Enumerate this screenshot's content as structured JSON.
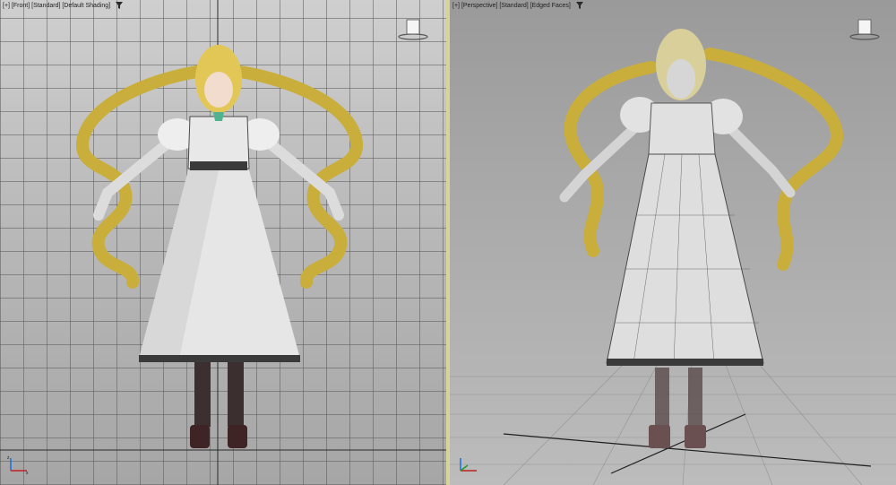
{
  "viewports": {
    "front": {
      "label_plus": "[+]",
      "label_view": "[Front]",
      "label_style": "[Standard]",
      "label_shading": "[Default Shading]"
    },
    "perspective": {
      "label_plus": "[+]",
      "label_view": "[Perspective]",
      "label_style": "[Standard]",
      "label_shading": "[Edged Faces]"
    }
  },
  "icons": {
    "filter": "funnel-icon",
    "viewcube": "viewcube-icon",
    "axis": "axis-tripod-icon"
  },
  "colors": {
    "active_border": "#d7d49a",
    "hair": "#d9c04a",
    "dress": "#e6e6e6",
    "stockings": "#3b2f2f"
  }
}
